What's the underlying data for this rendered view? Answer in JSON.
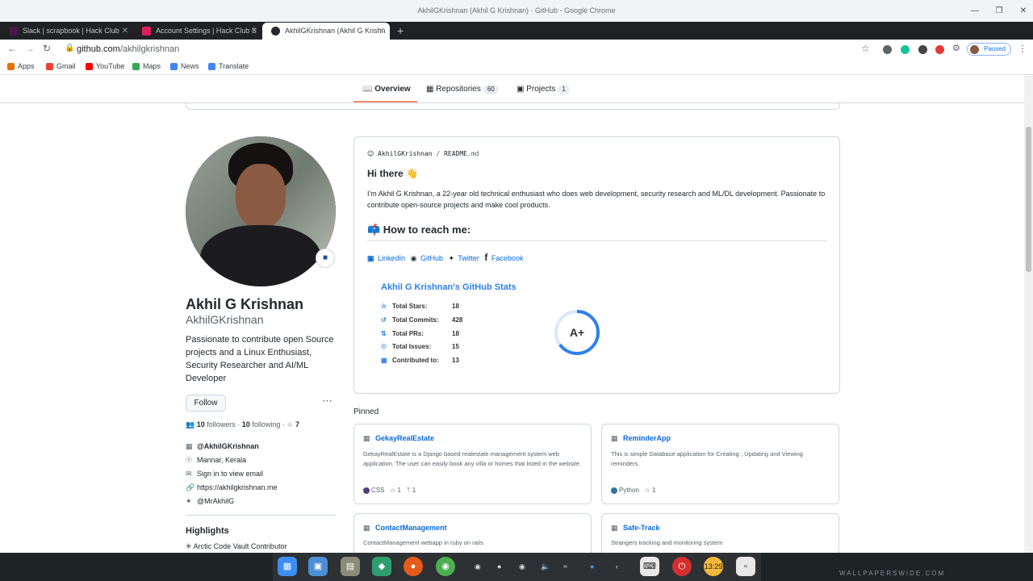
{
  "window": {
    "title": "AkhilGKrishnan (Akhil G Krishnan) · GitHub - Google Chrome"
  },
  "tabs": [
    {
      "label": "Slack | scrapbook | Hack Club",
      "color": "#4a154b"
    },
    {
      "label": "Account Settings | Hack Club S",
      "color": "#e01e5a"
    },
    {
      "label": "AkhilGKrishnan (Akhil G Krishn",
      "color": "#24292f"
    }
  ],
  "toolbar": {
    "url_host": "github.com",
    "url_path": "/akhilgkrishnan",
    "profile": "Paused"
  },
  "bookmarks": [
    "Apps",
    "Gmail",
    "YouTube",
    "Maps",
    "News",
    "Translate"
  ],
  "nav": {
    "overview": "Overview",
    "repositories": "Repositories",
    "repositories_count": "60",
    "projects": "Projects",
    "projects_count": "1"
  },
  "profile": {
    "name": "Akhil G Krishnan",
    "login": "AkhilGKrishnan",
    "bio": "Passionate to contribute open Source projects and a Linux Enthusiast, Security Researcher and AI/ML Developer",
    "follow_label": "Follow",
    "followers": "10",
    "followers_label": "followers",
    "following": "10",
    "following_label": "following",
    "stars": "7",
    "org": "@AkhilGKrishnan",
    "location": "Mannar, Kerala",
    "email": "Sign in to view email",
    "website": "https://akhilgkrishnan.me",
    "twitter": "@MrAkhilG",
    "highlights_title": "Highlights",
    "highlight_item": "Arctic Code Vault Contributor"
  },
  "readme": {
    "owner": "AkhilGKrishnan",
    "sep": "/",
    "file": "README",
    "ext": ".md",
    "greeting": "Hi there 👋",
    "intro": "I'm Akhil G Krishnan, a 22-year old technical enthusiast who does web development, security research and ML/DL development. Passionate to contribute open-source projects and make cool products.",
    "reach_title": "📫 How to reach me:",
    "links": [
      "LinkedIn",
      "GitHub",
      "Twitter",
      "Facebook"
    ],
    "stats": {
      "title": "Akhil G Krishnan's GitHub Stats",
      "rows": [
        {
          "label": "Total Stars:",
          "value": "18"
        },
        {
          "label": "Total Commits:",
          "value": "428"
        },
        {
          "label": "Total PRs:",
          "value": "18"
        },
        {
          "label": "Total Issues:",
          "value": "15"
        },
        {
          "label": "Contributed to:",
          "value": "13"
        }
      ],
      "grade": "A+",
      "grade_fill": 0.65
    }
  },
  "pinned": {
    "title": "Pinned",
    "cards": [
      {
        "name": "GekayRealEstate",
        "desc": "GekayRealEstate is a Django based realestate management system web application. The user can easily book any villa or homes that listed in the website.",
        "lang": "CSS",
        "lang_color": "#563d7c",
        "stars": "1",
        "forks": "1"
      },
      {
        "name": "ReminderApp",
        "desc": "This is simple Database application for Creating , Updating and Viewing reminders.",
        "lang": "Python",
        "lang_color": "#3572A5",
        "stars": "1",
        "forks": ""
      },
      {
        "name": "ContactManagement",
        "desc": "ContactManagement webapp in ruby on rails"
      },
      {
        "name": "Safe-Track",
        "desc": "Strangers tracking and monitoring system"
      }
    ]
  },
  "taskbar": {
    "clock": "13",
    "clock2": "29",
    "watermark": "WALLPAPERSWIDE.COM"
  }
}
